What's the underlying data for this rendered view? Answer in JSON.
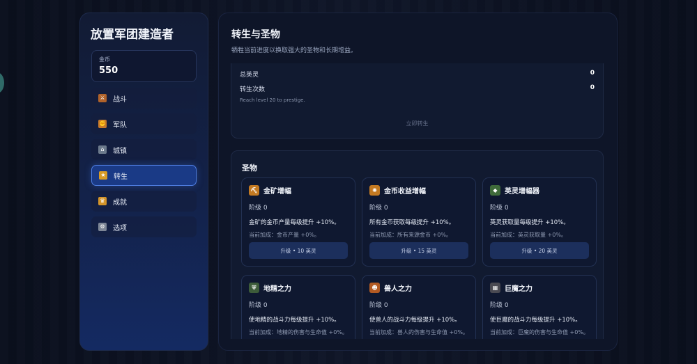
{
  "sidebar": {
    "title": "放置军团建造者",
    "gold": {
      "label": "金币",
      "value": "550"
    },
    "items": [
      {
        "label": "战斗",
        "icon": "crossed-swords-icon",
        "glyph": "⚔",
        "color": "#b0622a",
        "active": false
      },
      {
        "label": "军队",
        "icon": "army-icon",
        "glyph": "✊",
        "color": "#c6782b",
        "active": false
      },
      {
        "label": "城镇",
        "icon": "town-icon",
        "glyph": "⌂",
        "color": "#6c7a8c",
        "active": false
      },
      {
        "label": "转生",
        "icon": "star-icon",
        "glyph": "★",
        "color": "#d89b26",
        "active": true
      },
      {
        "label": "成就",
        "icon": "trophy-icon",
        "glyph": "♛",
        "color": "#d3942a",
        "active": false
      },
      {
        "label": "选项",
        "icon": "gear-icon",
        "glyph": "⚙",
        "color": "#7d8696",
        "active": false
      }
    ]
  },
  "main": {
    "title": "转生与圣物",
    "subtitle": "牺牲当前进度以换取强大的圣物和长期增益。",
    "prestige": {
      "total_heroes_label": "总英灵",
      "total_heroes_value": "0",
      "count_label": "转生次数",
      "count_value": "0",
      "note": "Reach level 20 to prestige.",
      "button_label": "立即转生"
    },
    "relics_title": "圣物",
    "relics": [
      {
        "name": "金矿增幅",
        "icon": "gold-mine-icon",
        "glyph": "⛏",
        "color": "#c47a22",
        "level": "阶级 0",
        "desc": "金矿的金币产量每级提升 +10%。",
        "bonus": "当前加成：金币产量 +0%。",
        "button": "升级 • 10 英灵"
      },
      {
        "name": "金币收益增幅",
        "icon": "coin-icon",
        "glyph": "✺",
        "color": "#c47a22",
        "level": "阶级 0",
        "desc": "所有金币获取每级提升 +10%。",
        "bonus": "当前加成：所有来源金币 +0%。",
        "button": "升级 • 15 英灵"
      },
      {
        "name": "英灵增幅器",
        "icon": "spirit-crystal-icon",
        "glyph": "◆",
        "color": "#3f6b3a",
        "level": "阶级 0",
        "desc": "英灵获取量每级提升 +10%。",
        "bonus": "当前加成：英灵获取量 +0%。",
        "button": "升级 • 20 英灵"
      },
      {
        "name": "地精之力",
        "icon": "goblin-shield-icon",
        "glyph": "⛨",
        "color": "#3d5c3a",
        "level": "阶级 0",
        "desc": "使地精的战斗力每级提升 +10%。",
        "bonus": "当前加成：地精的伤害与生命值 +0%。",
        "button": ""
      },
      {
        "name": "兽人之力",
        "icon": "orc-icon",
        "glyph": "☻",
        "color": "#b35a22",
        "level": "阶级 0",
        "desc": "使兽人的战斗力每级提升 +10%。",
        "bonus": "当前加成：兽人的伤害与生命值 +0%。",
        "button": ""
      },
      {
        "name": "巨魔之力",
        "icon": "troll-icon",
        "glyph": "▦",
        "color": "#4a4a52",
        "level": "阶级 0",
        "desc": "使巨魔的战斗力每级提升 +10%。",
        "bonus": "当前加成：巨魔的伤害与生命值 +0%。",
        "button": ""
      }
    ]
  }
}
